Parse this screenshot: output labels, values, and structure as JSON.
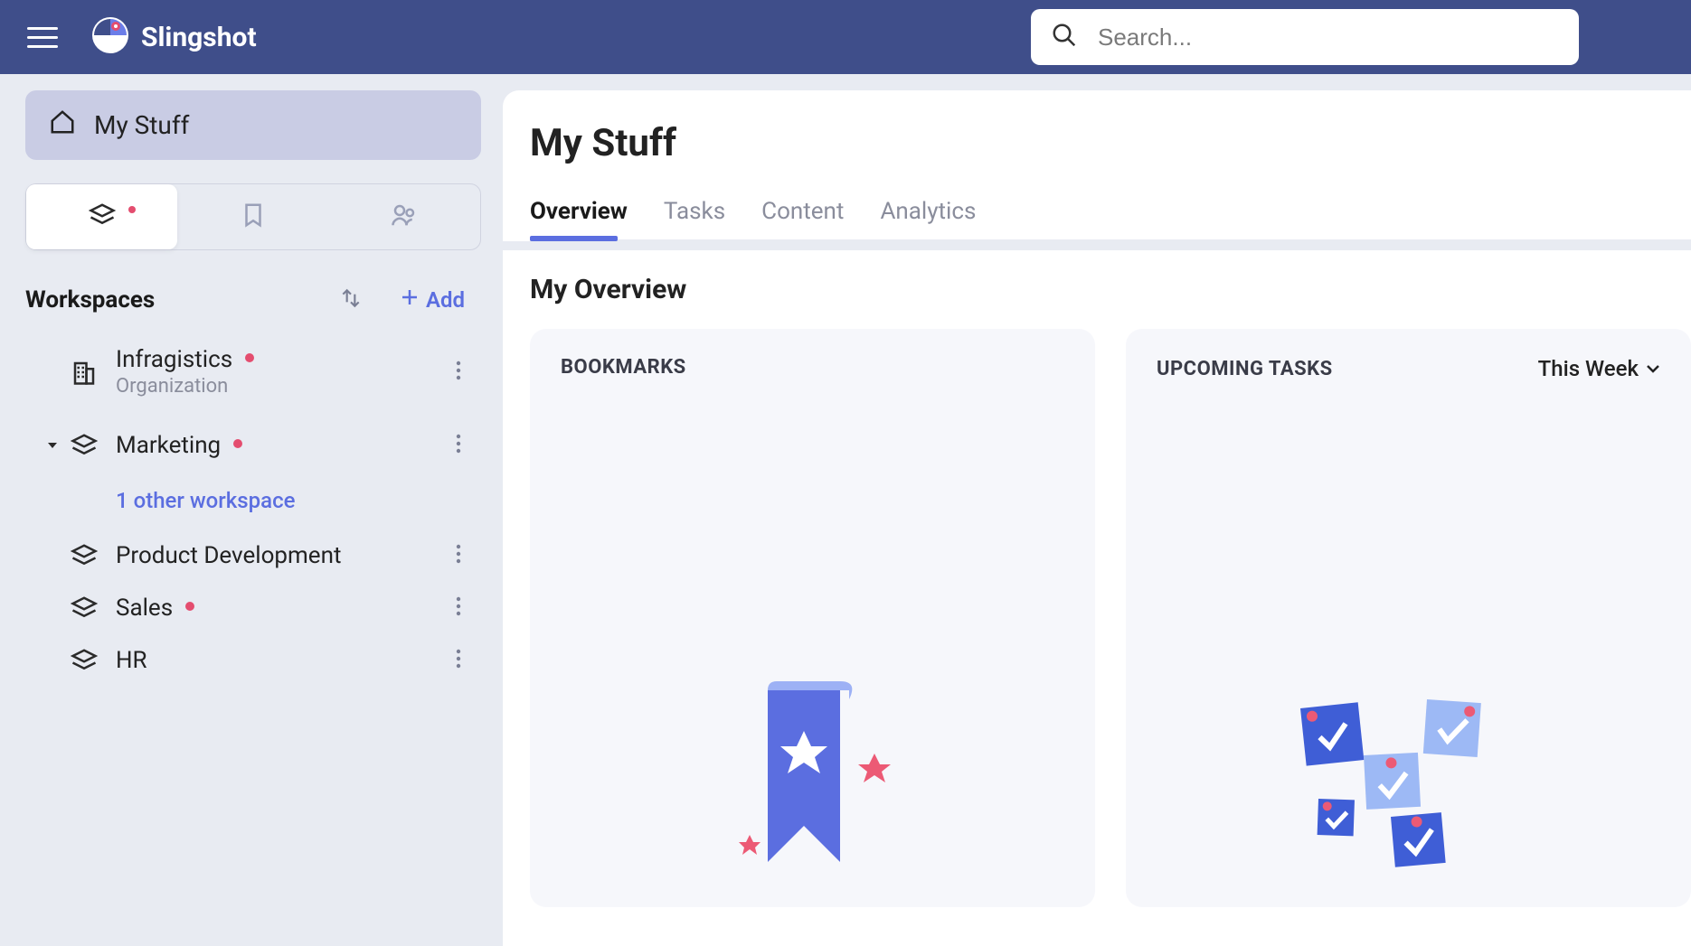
{
  "header": {
    "brand": "Slingshot",
    "search_placeholder": "Search..."
  },
  "sidebar": {
    "my_stuff": "My Stuff",
    "workspaces_label": "Workspaces",
    "add_label": "Add",
    "other_workspace": "1 other workspace",
    "items": {
      "infragistics": {
        "title": "Infragistics",
        "subtitle": "Organization"
      },
      "marketing": {
        "title": "Marketing"
      },
      "product_dev": {
        "title": "Product Development"
      },
      "sales": {
        "title": "Sales"
      },
      "hr": {
        "title": "HR"
      }
    }
  },
  "main": {
    "title": "My Stuff",
    "tabs": {
      "overview": "Overview",
      "tasks": "Tasks",
      "content": "Content",
      "analytics": "Analytics"
    },
    "overview_title": "My Overview",
    "cards": {
      "bookmarks_title": "BOOKMARKS",
      "upcoming_tasks_title": "UPCOMING TASKS",
      "tasks_range": "This Week"
    }
  }
}
